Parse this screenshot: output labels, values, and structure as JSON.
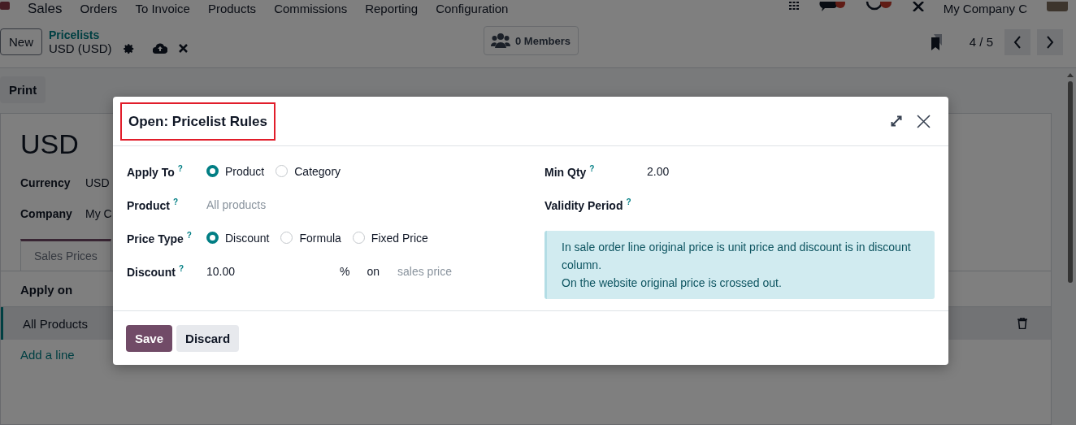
{
  "navbar": {
    "app": "Sales",
    "menu": [
      "Orders",
      "To Invoice",
      "Products",
      "Commissions",
      "Reporting",
      "Configuration"
    ],
    "company": "My Company C"
  },
  "control_panel": {
    "new_button": "New",
    "breadcrumb": "Pricelists",
    "record": "USD (USD)",
    "members": "0 Members",
    "pager": "4 / 5",
    "print": "Print"
  },
  "form": {
    "name": "USD",
    "fields": [
      {
        "label": "Currency",
        "value": "USD"
      },
      {
        "label": "Company",
        "value": "My C"
      }
    ],
    "tabs": [
      {
        "label": "Sales Prices",
        "selected": true
      }
    ],
    "table": {
      "columns": [
        "Apply on"
      ],
      "rows": [
        {
          "cells": [
            "All Products"
          ],
          "selected": true
        }
      ],
      "add_line": "Add a line"
    }
  },
  "dialog": {
    "title": "Open: Pricelist Rules",
    "highlighted": true,
    "left_fields": [
      {
        "kind": "radio",
        "label": "Apply To",
        "help": "?",
        "options": [
          {
            "label": "Product",
            "selected": true
          },
          {
            "label": "Category",
            "selected": false
          }
        ]
      },
      {
        "kind": "text",
        "label": "Product",
        "help": "?",
        "placeholder": "All products"
      },
      {
        "kind": "radio",
        "label": "Price Type",
        "help": "?",
        "options": [
          {
            "label": "Discount",
            "selected": true
          },
          {
            "label": "Formula",
            "selected": false
          },
          {
            "label": "Fixed Price",
            "selected": false
          }
        ]
      },
      {
        "kind": "discount",
        "label": "Discount",
        "help": "?",
        "value": "10.00",
        "unit": "%",
        "joiner": "on",
        "placeholder": "sales price"
      }
    ],
    "right_fields": [
      {
        "kind": "text",
        "label": "Min Qty",
        "help": "?",
        "value": "2.00"
      },
      {
        "kind": "empty",
        "label": "Validity Period",
        "help": "?"
      }
    ],
    "alert": [
      "In sale order line original price is unit price and discount is in discount column.",
      "On the website original price is crossed out."
    ],
    "buttons": [
      {
        "label": "Save",
        "kind": "primary"
      },
      {
        "label": "Discard",
        "kind": "secondary"
      }
    ]
  }
}
